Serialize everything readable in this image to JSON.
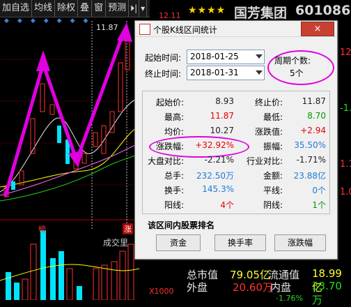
{
  "toolbar": {
    "items": [
      "加自选",
      "均线",
      "除权",
      "叠",
      "窗",
      "预测"
    ],
    "next_icon": "⏵|",
    "menu_icon": "▾"
  },
  "header": {
    "stars": "★★★★",
    "stock_name": "国芳集团",
    "stock_code": "601086"
  },
  "chart": {
    "price_labels": [
      "12.11",
      "11.87"
    ],
    "flag_label": "榜",
    "flag_label2": "涨",
    "volume_label": "成交里",
    "bottom_labels": [
      "X1000"
    ]
  },
  "right_panel": {
    "rows": [
      {
        "label": "总市值",
        "value": "79.05亿",
        "label2": "流通值",
        "value2": "18.99亿"
      },
      {
        "label": "外盘",
        "value": "20.60万",
        "label2": "内盘",
        "value2": "33.70万"
      }
    ],
    "right_vals": [
      "12.",
      "-1.",
      "1.1",
      "1.0"
    ],
    "pct_bottom": "-1.76%"
  },
  "dialog": {
    "title": "个股K线区间统计",
    "close_label": "×",
    "start_label": "起始时间:",
    "start_value": "2018-01-25",
    "end_label": "终止时间:",
    "end_value": "2018-01-31",
    "period_label": "周期个数:",
    "period_value": "5个",
    "stats": [
      {
        "k1": "起始价:",
        "v1": "8.93",
        "c1": "black",
        "k2": "终止价:",
        "v2": "11.87",
        "c2": "black"
      },
      {
        "k1": "最高:",
        "v1": "11.87",
        "c1": "red",
        "k2": "最低:",
        "v2": "8.70",
        "c2": "green"
      },
      {
        "k1": "均价:",
        "v1": "10.27",
        "c1": "black",
        "k2": "涨跌值:",
        "v2": "+2.94",
        "c2": "red"
      },
      {
        "k1": "涨跌幅:",
        "v1": "+32.92%",
        "c1": "red",
        "k2": "振幅:",
        "v2": "35.50%",
        "c2": "blue"
      },
      {
        "k1": "大盘对比:",
        "v1": "-2.21%",
        "c1": "black",
        "k2": "行业对比:",
        "v2": "-1.71%",
        "c2": "black"
      },
      {
        "k1": "总手:",
        "v1": "232.50万",
        "c1": "blue",
        "k2": "金额:",
        "v2": "23.88亿",
        "c2": "blue"
      },
      {
        "k1": "换手:",
        "v1": "145.3%",
        "c1": "blue",
        "k2": "平线:",
        "v2": "0个",
        "c2": "blue"
      },
      {
        "k1": "阳线:",
        "v1": "4个",
        "c1": "red",
        "k2": "阴线:",
        "v2": "1个",
        "c2": "green"
      }
    ],
    "ranking_title": "该区间内股票排名",
    "buttons": [
      "资金",
      "换手率",
      "涨跌幅"
    ]
  }
}
